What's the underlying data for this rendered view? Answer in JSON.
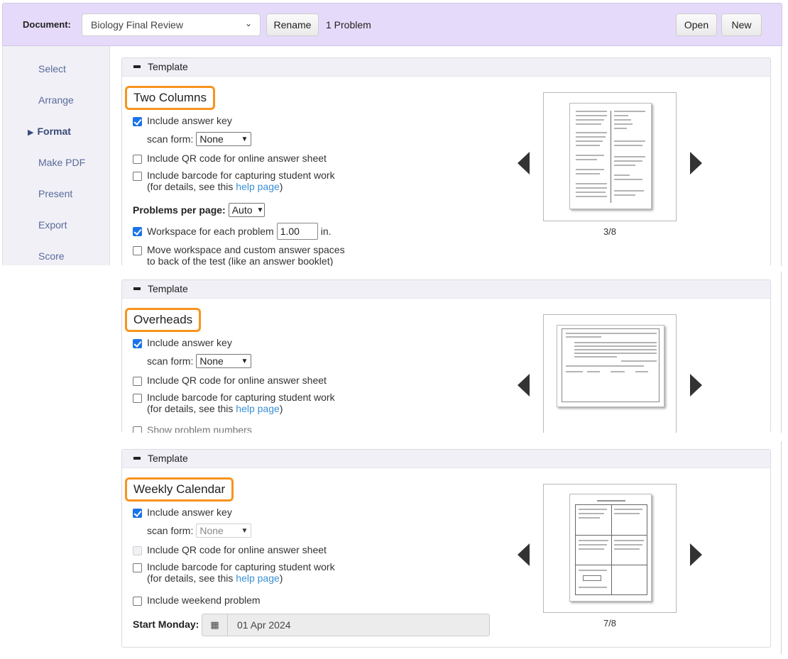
{
  "toolbar": {
    "document_label": "Document:",
    "document_value": "Biology Final Review",
    "rename_label": "Rename",
    "problem_count": "1 Problem",
    "open_label": "Open",
    "new_label": "New"
  },
  "sidebar": {
    "items": [
      {
        "label": "Select",
        "active": false
      },
      {
        "label": "Arrange",
        "active": false
      },
      {
        "label": "Format",
        "active": true
      },
      {
        "label": "Make PDF",
        "active": false
      },
      {
        "label": "Present",
        "active": false
      },
      {
        "label": "Export",
        "active": false
      },
      {
        "label": "Score",
        "active": false
      }
    ],
    "active_marker": "▶"
  },
  "panels": [
    {
      "header": "Template",
      "title": "Two Columns",
      "include_answer_key": {
        "label": "Include answer key",
        "checked": true
      },
      "scan_form": {
        "label": "scan form:",
        "value": "None"
      },
      "qr_code": {
        "label": "Include QR code for online answer sheet",
        "checked": false
      },
      "barcode": {
        "label": "Include barcode for capturing student work",
        "checked": false
      },
      "details_prefix": "(for details, see this ",
      "help_link": "help page",
      "details_suffix": ")",
      "problems_per_page": {
        "label": "Problems per page:",
        "value": "Auto"
      },
      "workspace": {
        "label": "Workspace for each problem",
        "value": "1.00",
        "unit": "in.",
        "checked": true
      },
      "move_workspace": {
        "label": "Move workspace and custom answer spaces",
        "label2": "to back of the test (like an answer booklet)",
        "checked": false
      },
      "page_indicator": "3/8"
    },
    {
      "header": "Template",
      "title": "Overheads",
      "include_answer_key": {
        "label": "Include answer key",
        "checked": true
      },
      "scan_form": {
        "label": "scan form:",
        "value": "None"
      },
      "qr_code": {
        "label": "Include QR code for online answer sheet",
        "checked": false
      },
      "barcode": {
        "label": "Include barcode for capturing student work",
        "checked": false
      },
      "details_prefix": "(for details, see this ",
      "help_link": "help page",
      "details_suffix": ")",
      "show_problem_numbers": {
        "label": "Show problem numbers",
        "checked": false
      }
    },
    {
      "header": "Template",
      "title": "Weekly Calendar",
      "include_answer_key": {
        "label": "Include answer key",
        "checked": true
      },
      "scan_form": {
        "label": "scan form:",
        "value": "None",
        "disabled": true
      },
      "qr_code": {
        "label": "Include QR code for online answer sheet",
        "checked": false,
        "disabled": true
      },
      "barcode": {
        "label": "Include barcode for capturing student work",
        "checked": false
      },
      "details_prefix": "(for details, see this ",
      "help_link": "help page",
      "details_suffix": ")",
      "weekend_problem": {
        "label": "Include weekend problem",
        "checked": false
      },
      "start_monday": {
        "label": "Start Monday:",
        "value": "01 Apr 2024"
      },
      "page_indicator": "7/8"
    }
  ],
  "colors": {
    "toolbar_bg": "#e6dafa",
    "highlight_border": "#f7941d",
    "checkbox_checked": "#1a73e8",
    "link": "#3a8fd6",
    "sidebar_text": "#5a6a9a"
  }
}
